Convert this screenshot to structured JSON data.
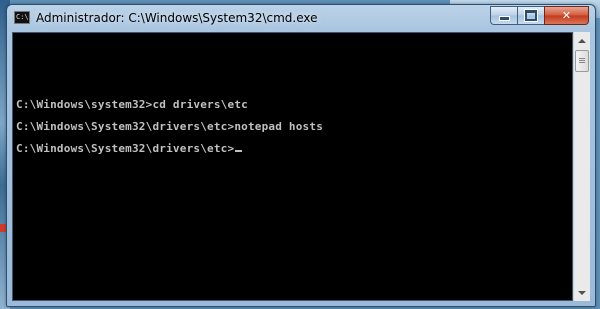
{
  "window": {
    "title": "Administrador: C:\\Windows\\System32\\cmd.exe",
    "icon": "cmd-icon",
    "icon_text": "C:\\",
    "buttons": [
      "minimize",
      "maximize",
      "close"
    ]
  },
  "console": {
    "lines": [
      "C:\\Windows\\system32>cd drivers\\etc",
      "C:\\Windows\\System32\\drivers\\etc>notepad hosts",
      "C:\\Windows\\System32\\drivers\\etc>"
    ],
    "colors": {
      "background": "#000000",
      "text": "#c0c0c0"
    }
  }
}
